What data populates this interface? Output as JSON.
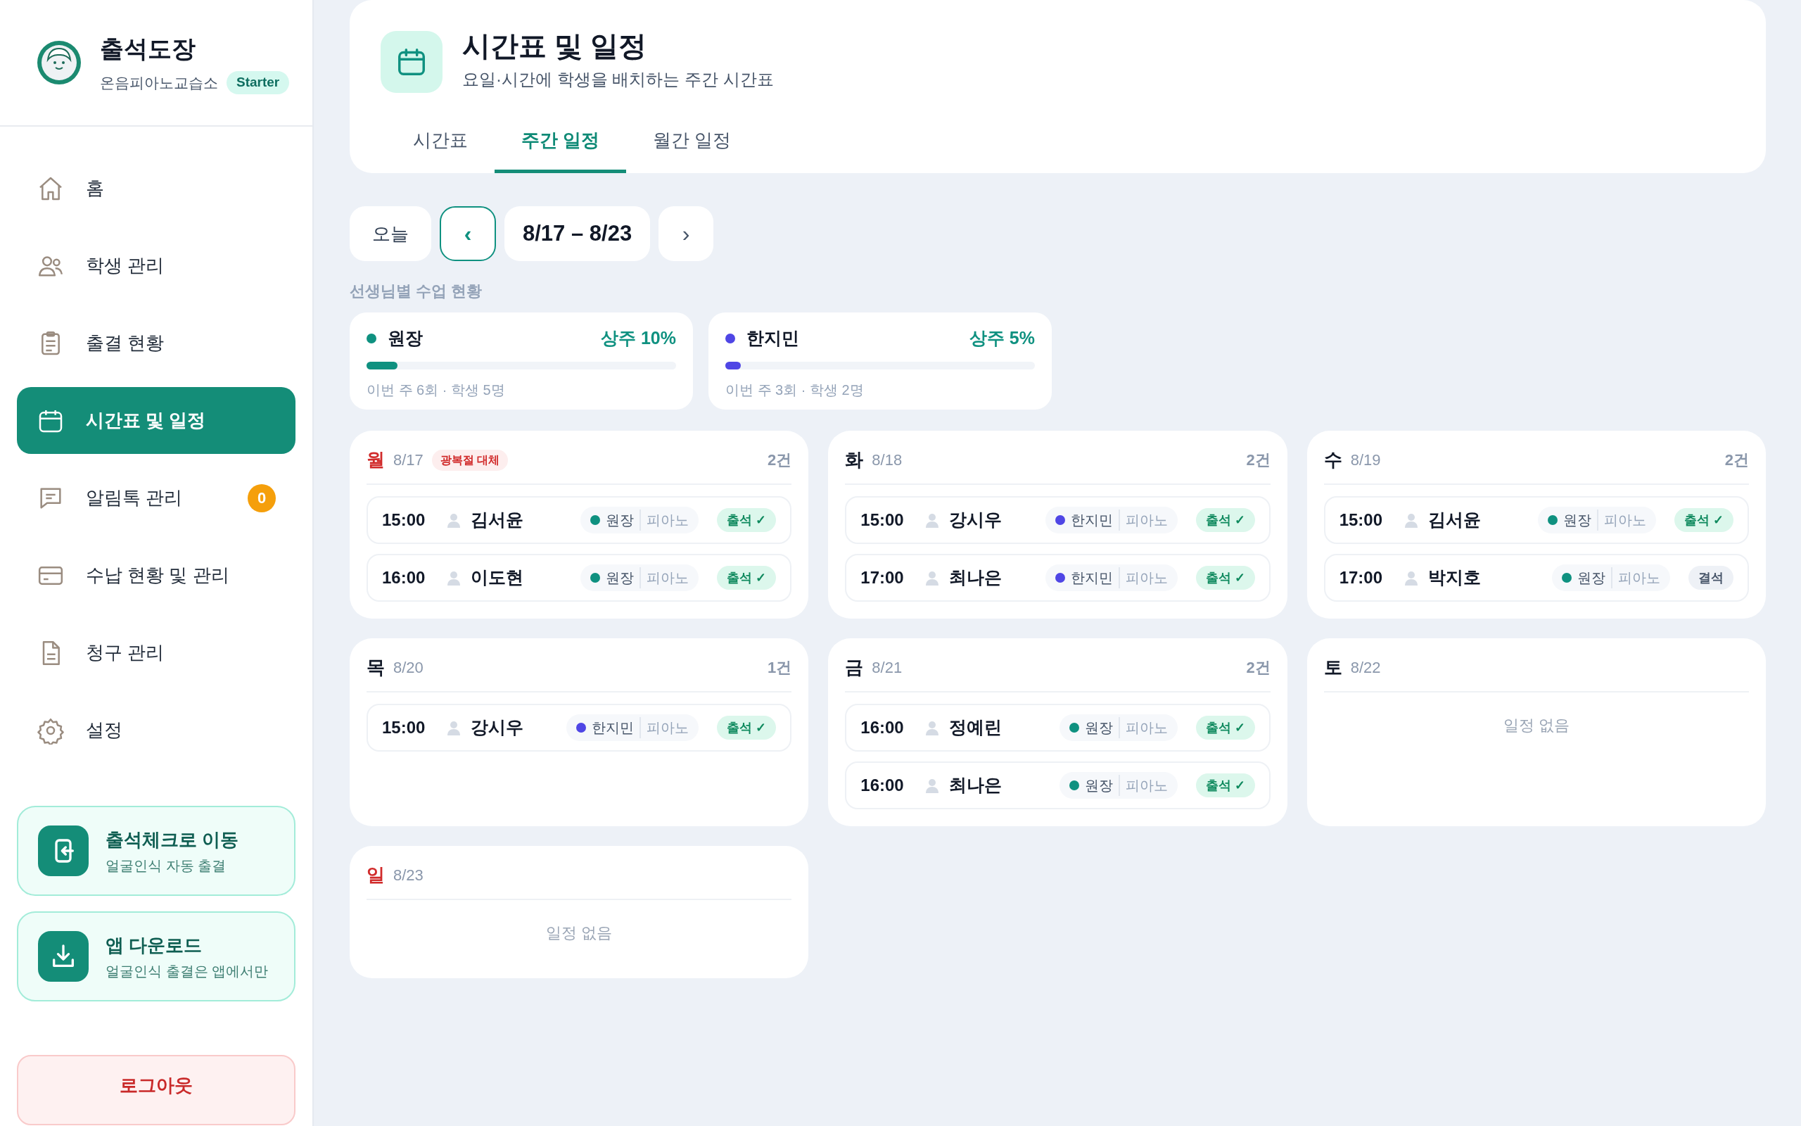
{
  "sidebar": {
    "brand": {
      "title": "출석도장",
      "academy": "온음피아노교습소",
      "plan": "Starter"
    },
    "items": [
      {
        "label": "홈",
        "selected": false
      },
      {
        "label": "학생 관리",
        "selected": false
      },
      {
        "label": "출결 현황",
        "selected": false
      },
      {
        "label": "시간표 및 일정",
        "selected": true
      },
      {
        "label": "알림톡 관리",
        "selected": false,
        "badge": "0"
      },
      {
        "label": "수납 현황 및 관리",
        "selected": false
      },
      {
        "label": "청구 관리",
        "selected": false
      },
      {
        "label": "설정",
        "selected": false
      }
    ],
    "promos": [
      {
        "title": "출석체크로 이동",
        "subtitle": "얼굴인식 자동 출결"
      },
      {
        "title": "앱 다운로드",
        "subtitle": "얼굴인식 출결은 앱에서만"
      }
    ],
    "logout": "로그아웃"
  },
  "header": {
    "title": "시간표 및 일정",
    "subtitle": "요일·시간에 학생을 배치하는 주간 시간표",
    "tabs": [
      {
        "label": "시간표",
        "selected": false
      },
      {
        "label": "주간 일정",
        "selected": true
      },
      {
        "label": "월간 일정",
        "selected": false
      }
    ]
  },
  "week_nav": {
    "today": "오늘",
    "prev": "‹",
    "range": "8/17 – 8/23",
    "next": "›"
  },
  "teacher_section": {
    "title": "선생님별 수업 현황",
    "teachers": [
      {
        "name": "원장",
        "color": "#0f9180",
        "rate": "상주 10%",
        "level": 0.1,
        "summary": "이번 주 6회 · 학생 5명"
      },
      {
        "name": "한지민",
        "color": "#4f46e5",
        "rate": "상주 5%",
        "level": 0.05,
        "summary": "이번 주 3회 · 학생 2명"
      }
    ]
  },
  "days": [
    {
      "day": "월",
      "date": "8/17",
      "holiday": true,
      "tag": "광복절 대체",
      "count": "2건",
      "entries": [
        {
          "time": "15:00",
          "student": "김서윤",
          "teacher": "원장",
          "color": "#0f9180",
          "subject": "피아노",
          "status": "출석 ✓",
          "kind": "present"
        },
        {
          "time": "16:00",
          "student": "이도현",
          "teacher": "원장",
          "color": "#0f9180",
          "subject": "피아노",
          "status": "출석 ✓",
          "kind": "present"
        }
      ]
    },
    {
      "day": "화",
      "date": "8/18",
      "holiday": false,
      "count": "2건",
      "entries": [
        {
          "time": "15:00",
          "student": "강시우",
          "teacher": "한지민",
          "color": "#4f46e5",
          "subject": "피아노",
          "status": "출석 ✓",
          "kind": "present"
        },
        {
          "time": "17:00",
          "student": "최나은",
          "teacher": "한지민",
          "color": "#4f46e5",
          "subject": "피아노",
          "status": "출석 ✓",
          "kind": "present"
        }
      ]
    },
    {
      "day": "수",
      "date": "8/19",
      "holiday": false,
      "count": "2건",
      "entries": [
        {
          "time": "15:00",
          "student": "김서윤",
          "teacher": "원장",
          "color": "#0f9180",
          "subject": "피아노",
          "status": "출석 ✓",
          "kind": "present"
        },
        {
          "time": "17:00",
          "student": "박지호",
          "teacher": "원장",
          "color": "#0f9180",
          "subject": "피아노",
          "status": "결석",
          "kind": "absent"
        }
      ]
    },
    {
      "day": "목",
      "date": "8/20",
      "holiday": false,
      "count": "1건",
      "entries": [
        {
          "time": "15:00",
          "student": "강시우",
          "teacher": "한지민",
          "color": "#4f46e5",
          "subject": "피아노",
          "status": "출석 ✓",
          "kind": "present"
        }
      ]
    },
    {
      "day": "금",
      "date": "8/21",
      "holiday": false,
      "count": "2건",
      "entries": [
        {
          "time": "16:00",
          "student": "정예린",
          "teacher": "원장",
          "color": "#0f9180",
          "subject": "피아노",
          "status": "출석 ✓",
          "kind": "present"
        },
        {
          "time": "16:00",
          "student": "최나은",
          "teacher": "원장",
          "color": "#0f9180",
          "subject": "피아노",
          "status": "출석 ✓",
          "kind": "present"
        }
      ]
    },
    {
      "day": "토",
      "date": "8/22",
      "holiday": false,
      "empty": "일정 없음"
    },
    {
      "day": "일",
      "date": "8/23",
      "holiday": true,
      "empty": "일정 없음"
    }
  ]
}
